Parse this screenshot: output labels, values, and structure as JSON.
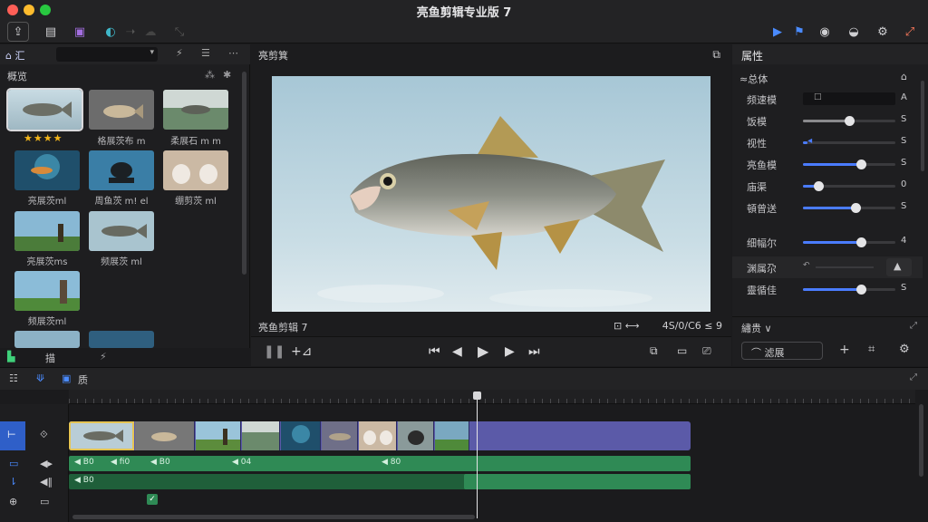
{
  "app": {
    "title": "亮鱼剪辑专业版 7"
  },
  "browser": {
    "tab_label": "⌂ 汇",
    "section_title": "概览",
    "rating": "★★★★",
    "clips": [
      {
        "label": ""
      },
      {
        "label": "格展茨布 m"
      },
      {
        "label": "柔展石 m m"
      },
      {
        "label": "亮展茨ml"
      },
      {
        "label": "周鱼茨 m! el"
      },
      {
        "label": "绷剪茨 ml"
      },
      {
        "label": "亮展茨ms"
      },
      {
        "label": "频展茨 ml"
      },
      {
        "label": "频展茨ml"
      }
    ],
    "footer_label": "描"
  },
  "viewer": {
    "title": "亮剪箕",
    "clip_name": "亮鱼剪辑 7",
    "timecode": "4S/0/C6 ≤ 9"
  },
  "inspector": {
    "tab_label": "属性",
    "section_label": "≈总体",
    "rows": [
      {
        "label": "频速模",
        "value": "A",
        "fill": 0
      },
      {
        "label": "饭模",
        "value": "S",
        "fill": 0.5
      },
      {
        "label": "视性",
        "value": "S",
        "fill": 0.05
      },
      {
        "label": "亮鱼模",
        "value": "S",
        "fill": 0.63
      },
      {
        "label": "庙渠",
        "value": "0",
        "fill": 0.17
      },
      {
        "label": "頓曾送",
        "value": "S",
        "fill": 0.57
      },
      {
        "label": "细幅尔",
        "value": "4",
        "fill": 0.63
      },
      {
        "label": "渊属尕",
        "value": "",
        "fill": 0.4
      },
      {
        "label": "靈循佳",
        "value": "S",
        "fill": 0.63
      }
    ],
    "lower_section": "繡贵 ∨",
    "footer_button": "⌒ 滤展"
  },
  "timeline": {
    "tab_label": "质",
    "audio_labels": [
      "◀ B0",
      "◀ fi0",
      "◀ B0",
      "◀ 04",
      "◀ 80",
      "◀ B0"
    ]
  },
  "colors": {
    "accent": "#4a8bff",
    "clip_strip": "#5b5aa8",
    "audio": "#2f8a55",
    "star": "#f2b51a"
  }
}
